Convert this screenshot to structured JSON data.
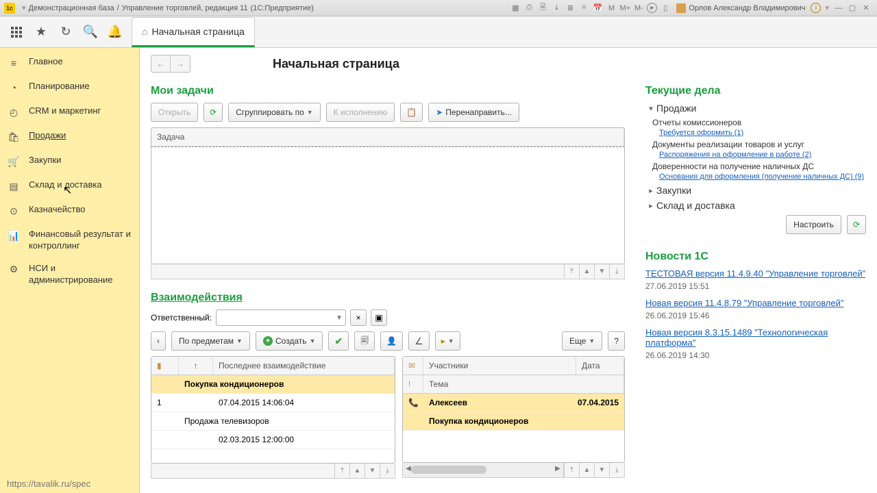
{
  "titlebar": {
    "app_icon_text": "1c",
    "db_name": "Демонстрационная база",
    "config": "Управление торговлей, редакция 11",
    "mode": "(1С:Предприятие)",
    "user": "Орлов Александр Владимирович",
    "m_labels": [
      "M",
      "M+",
      "M-"
    ]
  },
  "toolbar": {
    "home_tab": "Начальная страница"
  },
  "sidebar": {
    "items": [
      {
        "label": "Главное"
      },
      {
        "label": "Планирование"
      },
      {
        "label": "CRM и маркетинг"
      },
      {
        "label": "Продажи"
      },
      {
        "label": "Закупки"
      },
      {
        "label": "Склад и доставка"
      },
      {
        "label": "Казначейство"
      },
      {
        "label": "Финансовый результат и контроллинг"
      },
      {
        "label": "НСИ и администрирование"
      }
    ],
    "footer": "https://tavalik.ru/spec"
  },
  "page": {
    "title": "Начальная страница"
  },
  "tasks": {
    "title": "Мои задачи",
    "open_btn": "Открыть",
    "group_btn": "Сгруппировать по",
    "due_btn": "К исполнению",
    "forward_btn": "Перенаправить...",
    "column": "Задача"
  },
  "interactions": {
    "title": "Взаимодействия",
    "resp_label": "Ответственный:",
    "by_subject": "По предметам",
    "create": "Создать",
    "more": "Еще",
    "q": "?",
    "left_cols": {
      "c1": "",
      "c2": "↑",
      "c3": "Последнее взаимодействие"
    },
    "right_cols": {
      "c1": "",
      "c2": "Участники",
      "c3": "Дата",
      "r2c2": "Тема"
    },
    "rows_left": [
      {
        "subject": "Покупка кондиционеров",
        "n": "1",
        "dt": "07.04.2015 14:06:04"
      },
      {
        "subject": "Продажа телевизоров",
        "n": "",
        "dt": "02.03.2015 12:00:00"
      }
    ],
    "rows_right": [
      {
        "who": "Алексеев",
        "date": "07.04.2015",
        "theme": "Покупка кондиционеров"
      }
    ]
  },
  "current": {
    "title": "Текущие дела",
    "sales": "Продажи",
    "s1": "Отчеты комиссионеров",
    "s1a": "Требуется оформить (1)",
    "s2": "Документы реализации товаров и услуг",
    "s2a": "Распоряжения на оформление в работе (2)",
    "s3": "Доверенности на получение наличных ДС",
    "s3a": "Основания для оформления (получение наличных ДС) (9)",
    "purchases": "Закупки",
    "warehouse": "Склад и доставка",
    "configure": "Настроить"
  },
  "news": {
    "title": "Новости 1С",
    "n1": "ТЕСТОВАЯ версия 11.4.9.40 \"Управление торговлей\"",
    "d1": "27.06.2019 15:51",
    "n2": "Новая версия 11.4.8.79 \"Управление торговлей\"",
    "d2": "26.06.2019 15:46",
    "n3": "Новая версия 8.3.15.1489 \"Технологическая платформа\"",
    "d3": "26.06.2019 14:30"
  }
}
